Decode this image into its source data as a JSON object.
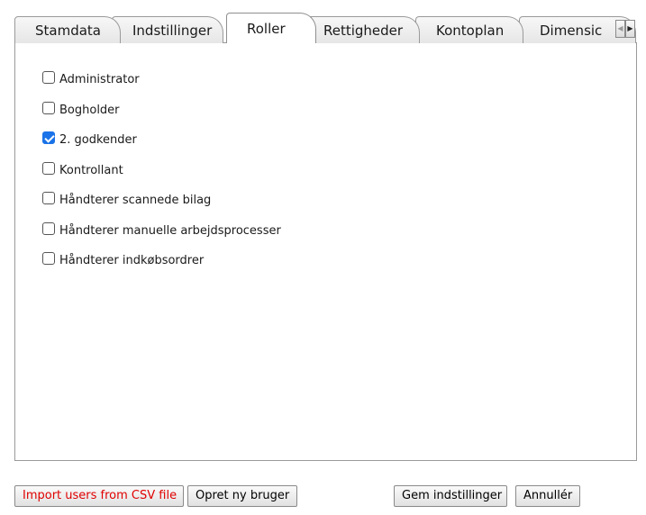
{
  "tabs": [
    {
      "label": "Stamdata",
      "active": false
    },
    {
      "label": "Indstillinger",
      "active": false
    },
    {
      "label": "Roller",
      "active": true
    },
    {
      "label": "Rettigheder",
      "active": false
    },
    {
      "label": "Kontoplan",
      "active": false
    },
    {
      "label": "Dimensic",
      "active": false
    }
  ],
  "tab_scroll": {
    "left_icon": "triangle-left-icon",
    "right_icon": "triangle-right-icon"
  },
  "roles": [
    {
      "label": "Administrator",
      "checked": false
    },
    {
      "label": "Bogholder",
      "checked": false
    },
    {
      "label": "2. godkender",
      "checked": true
    },
    {
      "label": "Kontrollant",
      "checked": false
    },
    {
      "label": "Håndterer scannede bilag",
      "checked": false
    },
    {
      "label": "Håndterer manuelle arbejdsprocesser",
      "checked": false
    },
    {
      "label": "Håndterer indkøbsordrer",
      "checked": false
    }
  ],
  "buttons": {
    "import_csv": "Import users from CSV file",
    "create_user": "Opret ny bruger",
    "save_settings": "Gem indstillinger",
    "cancel": "Annullér"
  },
  "colors": {
    "import_text": "#e00000",
    "checkbox_checked": "#1a73e8"
  }
}
